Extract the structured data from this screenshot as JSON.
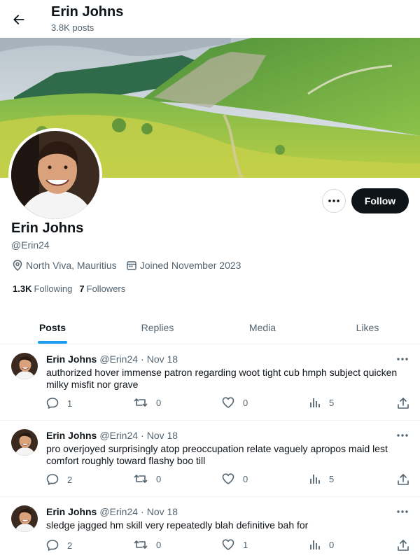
{
  "header": {
    "title": "Erin Johns",
    "subtitle": "3.8K posts"
  },
  "profile": {
    "name": "Erin Johns",
    "handle": "@Erin24",
    "location": "North Viva, Mauritius",
    "joined": "Joined November 2023",
    "following_count": "1.3K",
    "following_label": "Following",
    "followers_count": "7",
    "followers_label": "Followers",
    "follow_label": "Follow"
  },
  "tabs": [
    {
      "label": "Posts"
    },
    {
      "label": "Replies"
    },
    {
      "label": "Media"
    },
    {
      "label": "Likes"
    }
  ],
  "posts": [
    {
      "author": "Erin Johns",
      "handle": "@Erin24",
      "dot": "·",
      "time": "Nov 18",
      "text": "authorized hover immense patron regarding woot tight cub hmph subject quicken milky misfit nor grave",
      "replies": "1",
      "reposts": "0",
      "likes": "0",
      "views": "5"
    },
    {
      "author": "Erin Johns",
      "handle": "@Erin24",
      "dot": "·",
      "time": "Nov 18",
      "text": "pro overjoyed surprisingly atop preoccupation relate vaguely apropos maid lest comfort roughly toward flashy boo till",
      "replies": "2",
      "reposts": "0",
      "likes": "0",
      "views": "5"
    },
    {
      "author": "Erin Johns",
      "handle": "@Erin24",
      "dot": "·",
      "time": "Nov 18",
      "text": "sledge jagged hm skill very repeatedly blah definitive bah for",
      "replies": "2",
      "reposts": "0",
      "likes": "1",
      "views": "0"
    }
  ],
  "icons": {
    "back": "arrow-left-icon",
    "more": "ellipsis-icon",
    "location": "map-pin-icon",
    "calendar": "calendar-icon",
    "reply": "speech-bubble-icon",
    "repost": "repost-icon",
    "like": "heart-icon",
    "views": "bar-chart-icon",
    "share": "share-upload-icon"
  },
  "colors": {
    "accent": "#1d9bf0",
    "text": "#0f1419",
    "secondary": "#536471",
    "follow_bg": "#0f1419"
  }
}
